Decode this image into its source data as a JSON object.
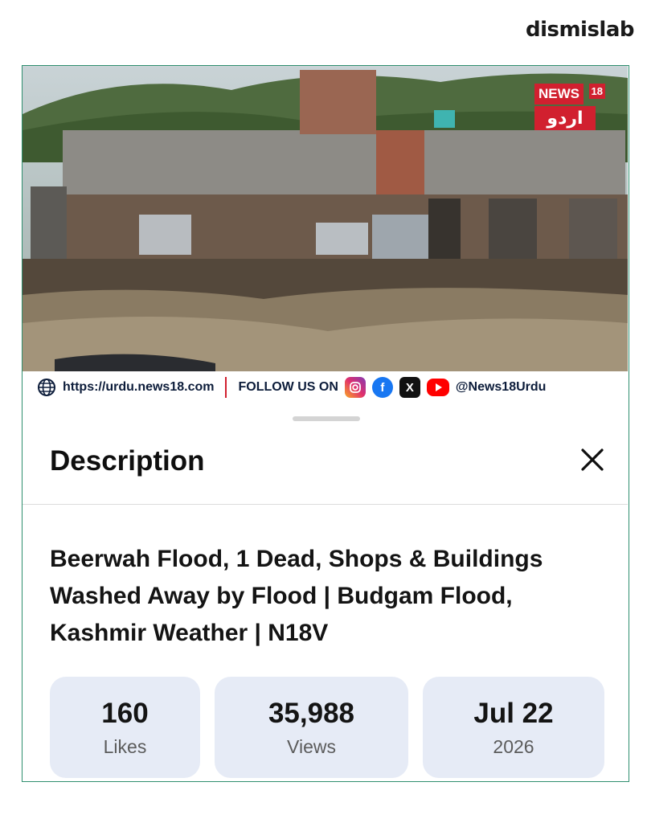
{
  "brand": {
    "name": "dismislab"
  },
  "video": {
    "logo_text": "NEWS",
    "logo_number": "18",
    "logo_urdu": "اردو",
    "ticker": {
      "url": "https://urdu.news18.com",
      "follow_label": "FOLLOW US ON",
      "handle": "@News18Urdu",
      "icons": [
        "globe-icon",
        "instagram-icon",
        "facebook-icon",
        "x-icon",
        "youtube-icon"
      ]
    }
  },
  "sheet": {
    "title": "Description",
    "close_icon": "close-icon",
    "video_title": "Beerwah Flood, 1 Dead, Shops & Buildings Washed Away by Flood | Budgam Flood, Kashmir Weather | N18V",
    "stats": {
      "likes": {
        "value": "160",
        "label": "Likes"
      },
      "views": {
        "value": "35,988",
        "label": "Views"
      },
      "date": {
        "value": "Jul 22",
        "label": "2026"
      }
    }
  },
  "colors": {
    "frame_border": "#2f8f6f",
    "stat_background": "#e6ebf6",
    "news18_red": "#d1202f"
  }
}
